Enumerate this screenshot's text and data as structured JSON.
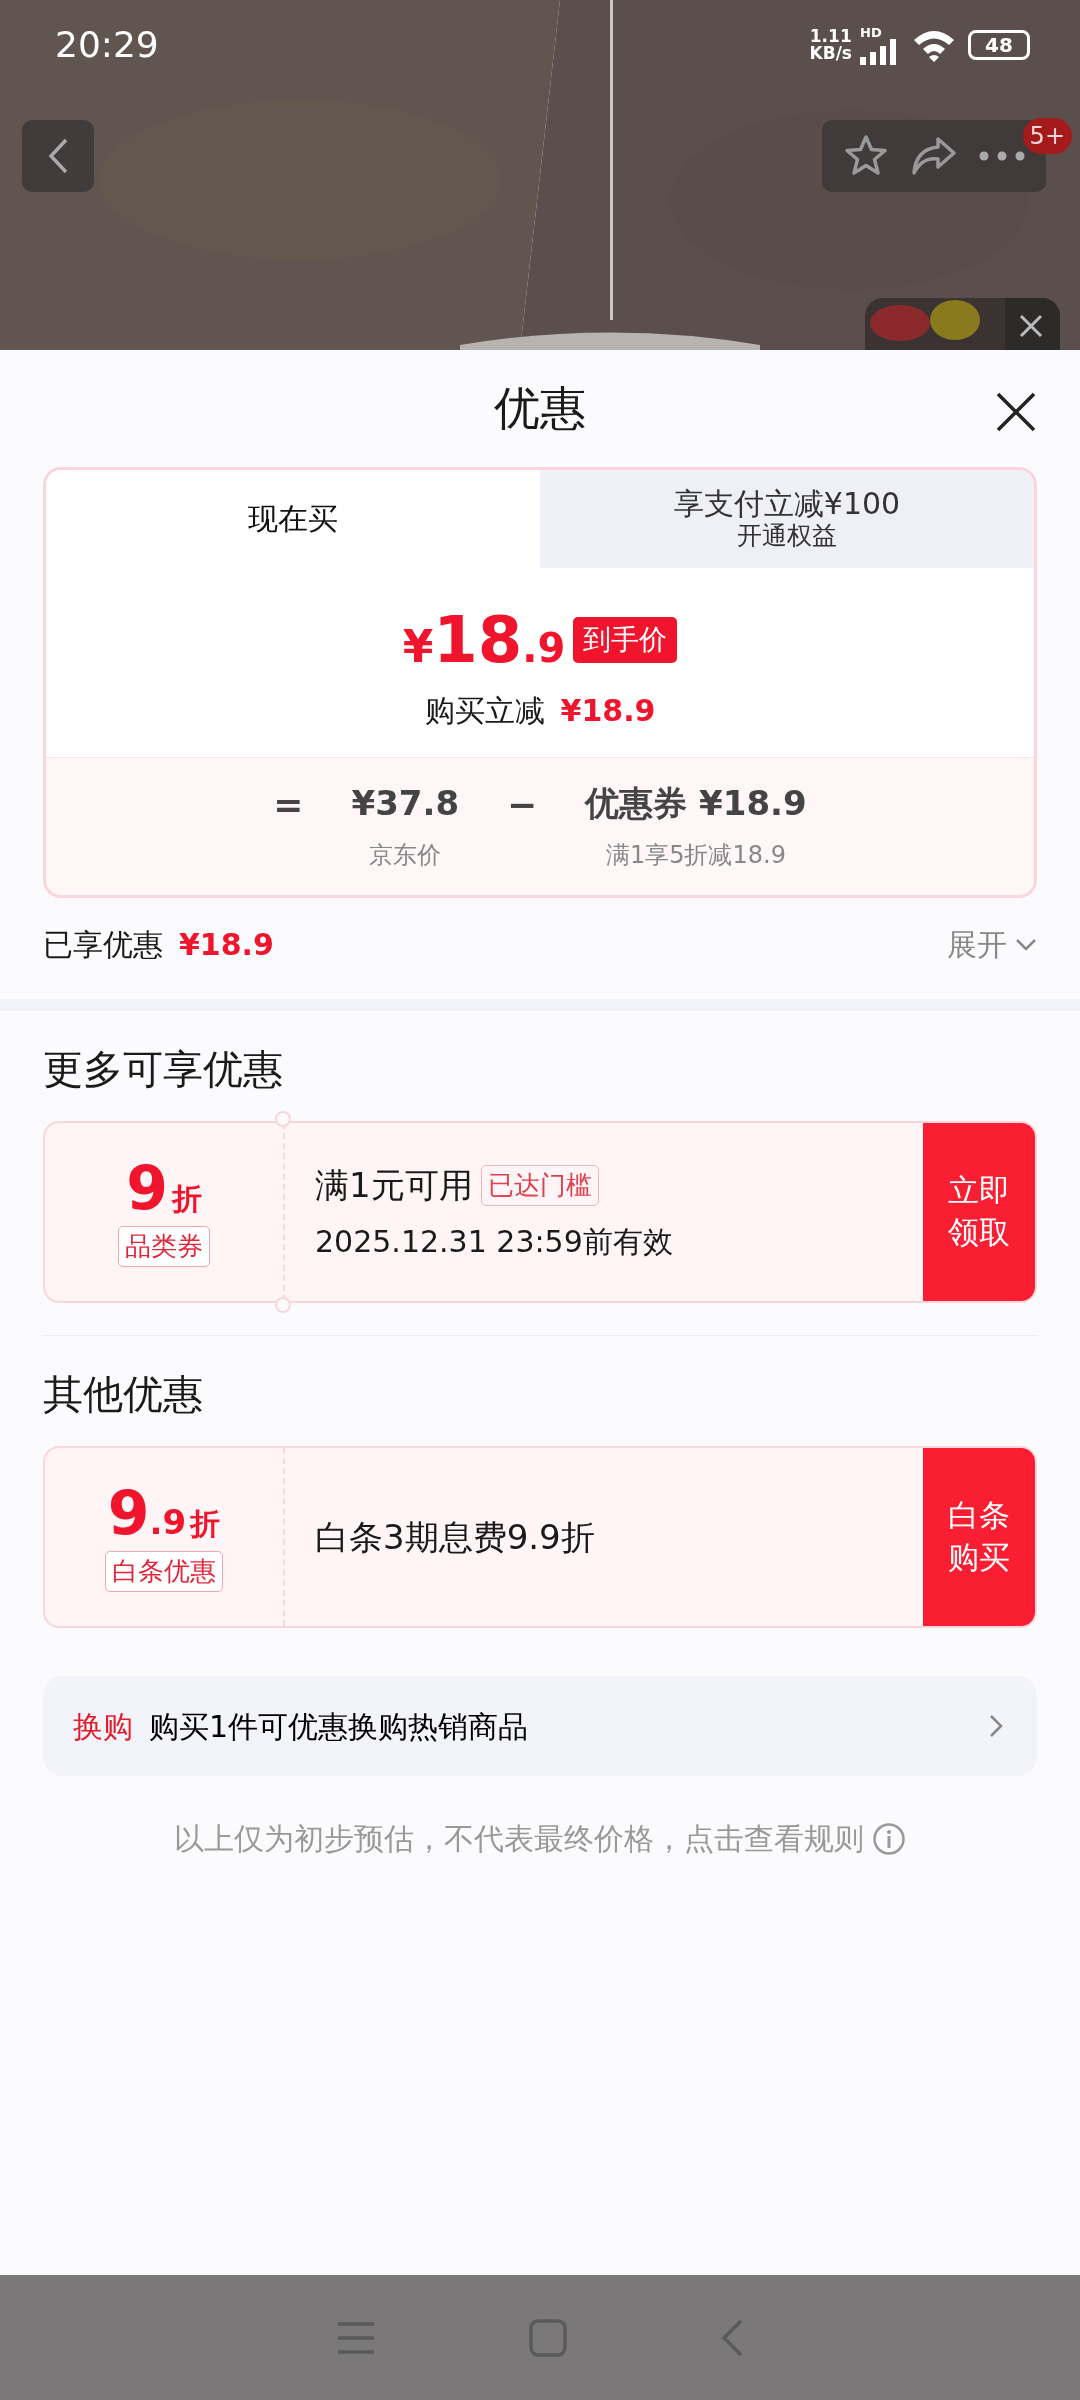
{
  "status_bar": {
    "time": "20:29",
    "net_speed": "1.11",
    "net_unit": "KB/s",
    "hd": "HD",
    "battery": "48"
  },
  "top_nav": {
    "badge": "5+"
  },
  "sheet": {
    "title": "优惠"
  },
  "tabs": [
    {
      "label": "现在买",
      "selected": true
    },
    {
      "label": "享支付立减¥100",
      "sublabel": "开通权益",
      "selected": false
    }
  ],
  "price": {
    "symbol": "¥",
    "main": "18",
    "fraction": ".9",
    "tag": "到手价",
    "reduction_label": "购买立减",
    "reduction_value": "¥18.9"
  },
  "formula": [
    {
      "kind": "operator",
      "text": "="
    },
    {
      "kind": "term",
      "value": "¥37.8",
      "caption": "京东价"
    },
    {
      "kind": "operator",
      "text": "−"
    },
    {
      "kind": "term",
      "value": "优惠券 ¥18.9",
      "caption": "满1享5折减18.9"
    }
  ],
  "enjoyed": {
    "label": "已享优惠",
    "value": "¥18.9",
    "expand": "展开"
  },
  "sections": [
    {
      "title": "更多可享优惠",
      "coupons": [
        {
          "kind": "ticket",
          "main": "9",
          "unit": "折",
          "type": "品类券",
          "title": "满1元可用",
          "tag": "已达门槛",
          "validity": "2025.12.31 23:59前有效",
          "action": [
            "立即",
            "领取"
          ]
        }
      ]
    },
    {
      "title": "其他优惠",
      "coupons": [
        {
          "kind": "plain",
          "main": "9",
          "fraction": ".9",
          "unit": "折",
          "type": "白条优惠",
          "title": "白条3期息费9.9折",
          "action": [
            "白条",
            "购买"
          ]
        }
      ]
    }
  ],
  "trade_in": {
    "label": "换购",
    "text": "购买1件可优惠换购热销商品"
  },
  "footer_note": "以上仅为初步预估，不代表最终价格，点击查看规则"
}
